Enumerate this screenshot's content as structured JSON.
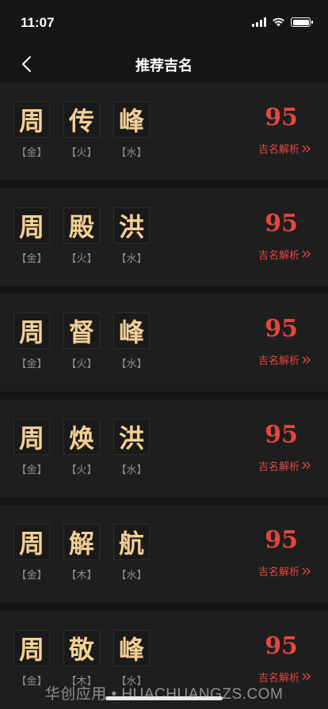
{
  "status_bar": {
    "time": "11:07"
  },
  "nav": {
    "title": "推荐吉名"
  },
  "cards": [
    {
      "chars": [
        "周",
        "传",
        "峰"
      ],
      "elements": [
        "【金】",
        "【火】",
        "【水】"
      ],
      "score": "95",
      "link": "吉名解析"
    },
    {
      "chars": [
        "周",
        "殿",
        "洪"
      ],
      "elements": [
        "【金】",
        "【火】",
        "【水】"
      ],
      "score": "95",
      "link": "吉名解析"
    },
    {
      "chars": [
        "周",
        "督",
        "峰"
      ],
      "elements": [
        "【金】",
        "【火】",
        "【水】"
      ],
      "score": "95",
      "link": "吉名解析"
    },
    {
      "chars": [
        "周",
        "焕",
        "洪"
      ],
      "elements": [
        "【金】",
        "【火】",
        "【水】"
      ],
      "score": "95",
      "link": "吉名解析"
    },
    {
      "chars": [
        "周",
        "解",
        "航"
      ],
      "elements": [
        "【金】",
        "【木】",
        "【水】"
      ],
      "score": "95",
      "link": "吉名解析"
    },
    {
      "chars": [
        "周",
        "敬",
        "峰"
      ],
      "elements": [
        "【金】",
        "【木】",
        "【水】"
      ],
      "score": "95",
      "link": "吉名解析"
    }
  ],
  "watermark": "华创应用 • HUACHUANGZS.COM",
  "colors": {
    "accent_red": "#e5463f",
    "name_gold": "#f2cf94",
    "background": "#161616",
    "card": "#1e1e1e"
  }
}
